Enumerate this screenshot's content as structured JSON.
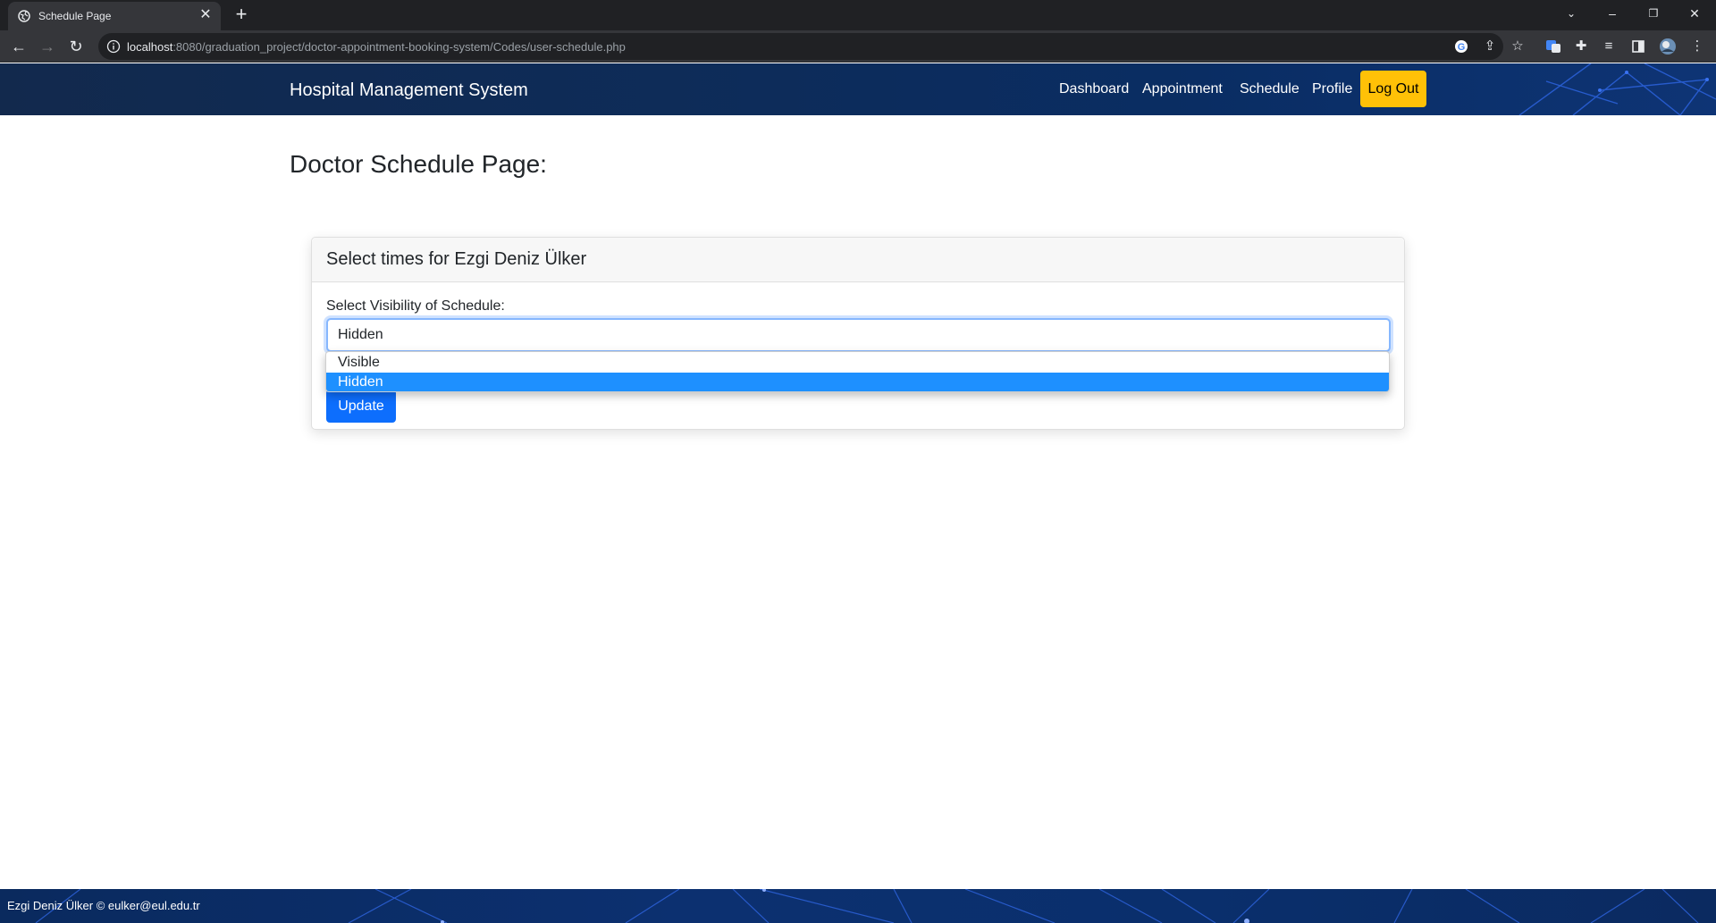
{
  "browser": {
    "tab_title": "Schedule Page",
    "url_host": "localhost",
    "url_rest": ":8080/graduation_project/doctor-appointment-booking-system/Codes/user-schedule.php"
  },
  "navbar": {
    "brand": "Hospital Management System",
    "links": [
      "Dashboard",
      "Appointment",
      "Schedule",
      "Profile"
    ],
    "logout": "Log Out"
  },
  "page": {
    "title": "Doctor Schedule Page:"
  },
  "card": {
    "header": "Select times for Ezgi Deniz Ülker",
    "visibility_label": "Select Visibility of Schedule:",
    "selected_value": "Hidden",
    "options": [
      "Visible",
      "Hidden"
    ],
    "update_button": "Update"
  },
  "footer": {
    "text": "Ezgi Deniz Ülker © eulker@eul.edu.tr"
  },
  "colors": {
    "navbar": "#0d2c5a",
    "logout": "#ffc107",
    "primary": "#0d6efd",
    "option_highlight": "#1e90ff"
  }
}
